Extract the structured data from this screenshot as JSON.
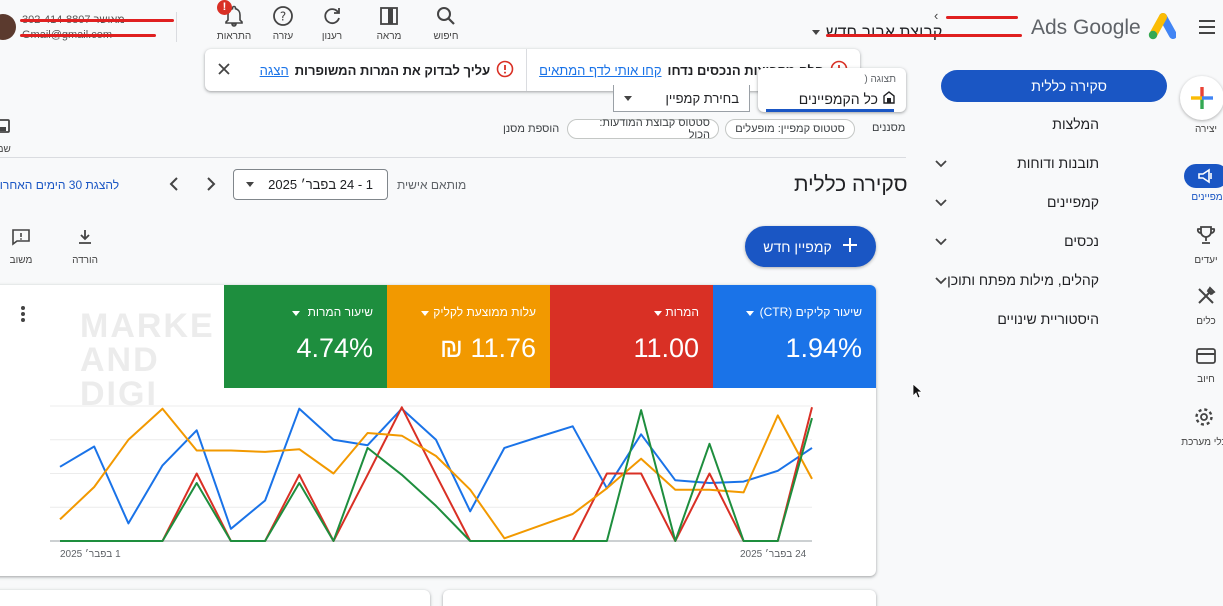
{
  "app": {
    "brand_text": "Ads Google",
    "account_name": "קבוצת אבוב חדש"
  },
  "user": {
    "phone": "302-414-8807 מאושר",
    "email": "Gmail@gmail.com"
  },
  "top_icons": [
    {
      "label": "חיפוש",
      "icon": "search-icon"
    },
    {
      "label": "מראה",
      "icon": "appearance-icon"
    },
    {
      "label": "רענון",
      "icon": "refresh-icon"
    },
    {
      "label": "עזרה",
      "icon": "help-icon"
    },
    {
      "label": "התראות",
      "icon": "bell-icon",
      "badge": "!"
    }
  ],
  "alert": {
    "left_text": "עליך לבדוק את המרות המשופרות",
    "left_link": "הצגה",
    "right_text": "חלק מקבוצות הנכסים נדחו",
    "right_link": "קחו אותי לדף המתאים"
  },
  "rail": [
    {
      "label": "יצירה",
      "icon": "create-plus-icon"
    },
    {
      "label": "קמפיינים",
      "icon": "campaigns-icon",
      "active": true
    },
    {
      "label": "יעדים",
      "icon": "trophy-icon"
    },
    {
      "label": "כלים",
      "icon": "tools-icon"
    },
    {
      "label": "חיוב",
      "icon": "billing-icon"
    },
    {
      "label": "כלי מערכת",
      "icon": "settings-icon"
    }
  ],
  "side_nav": {
    "active": "סקירה כללית",
    "items": [
      {
        "label": "המלצות",
        "chevron": false
      },
      {
        "label": "תובנות ודוחות",
        "chevron": true
      },
      {
        "label": "קמפיינים",
        "chevron": true
      },
      {
        "label": "נכסים",
        "chevron": true
      },
      {
        "label": "קהלים, מילות מפתח ותוכן",
        "chevron": true
      },
      {
        "label": "היסטוריית שינויים",
        "chevron": false
      }
    ]
  },
  "view_selector": {
    "label": "תצוגה (",
    "value": "כל הקמפיינים"
  },
  "campaign_selector": {
    "value": "בחירת קמפיין"
  },
  "filters": {
    "label": "מסננים",
    "chips": [
      "סטטוס קמפיין: מופעלים",
      "סטטוס קבוצת המודעות: הכול"
    ],
    "add": "הוספת מסנן"
  },
  "save_label": "שמי",
  "page_title": "סקירה כללית",
  "date": {
    "custom_label": "מותאם אישית",
    "range": "1 - 24 בפבר׳ 2025",
    "last_30": "להצגת 30 הימים האחרוני"
  },
  "actions": {
    "download": "הורדה",
    "feedback": "משוב"
  },
  "new_campaign": "קמפיין חדש",
  "metrics": [
    {
      "label": "שיעור קליקים (CTR)",
      "value": "1.94%",
      "color": "#1a73e8"
    },
    {
      "label": "המרות",
      "value": "11.00",
      "color": "#d93025"
    },
    {
      "label": "עלות ממוצעת לקליק",
      "value": "11.76 ₪",
      "color": "#f29900"
    },
    {
      "label": "שיעור המרות",
      "value": "4.74%",
      "color": "#1e8e3e"
    }
  ],
  "watermark": "MARKE AND DIGI",
  "chart_data": {
    "type": "line",
    "x": [
      "1",
      "2",
      "3",
      "4",
      "5",
      "6",
      "7",
      "8",
      "9",
      "10",
      "11",
      "12",
      "13",
      "14",
      "15",
      "16",
      "17",
      "18",
      "19",
      "20",
      "21",
      "22",
      "23",
      "24"
    ],
    "x_tick_labels": {
      "start": "1 בפבר׳ 2025",
      "end": "24 בפבר׳ 2025"
    },
    "ylim": [
      0,
      1
    ],
    "grid": true,
    "series": [
      {
        "color": "#1a73e8",
        "values": [
          0.55,
          0.7,
          0.13,
          0.56,
          0.82,
          0.09,
          0.3,
          0.98,
          0.75,
          0.71,
          0.98,
          0.75,
          0.22,
          0.69,
          0.77,
          0.85,
          0.39,
          0.79,
          0.45,
          0.43,
          0.44,
          0.52,
          0.69
        ]
      },
      {
        "color": "#d93025",
        "values": [
          0.0,
          0.0,
          0.0,
          0.0,
          0.5,
          0.0,
          0.0,
          0.49,
          0.0,
          0.49,
          0.99,
          0.49,
          0.0,
          0.0,
          0.0,
          0.0,
          0.5,
          0.5,
          0.0,
          0.5,
          0.0,
          0.0,
          0.99
        ]
      },
      {
        "color": "#f29900",
        "values": [
          0.16,
          0.4,
          0.75,
          0.98,
          0.67,
          0.67,
          0.66,
          0.68,
          0.5,
          0.8,
          0.78,
          0.63,
          0.38,
          0.02,
          0.11,
          0.2,
          0.39,
          0.61,
          0.38,
          0.38,
          0.36,
          0.93,
          0.46
        ]
      },
      {
        "color": "#1e8e3e",
        "values": [
          0.0,
          0.0,
          0.0,
          0.0,
          0.43,
          0.0,
          0.0,
          0.43,
          0.0,
          0.69,
          0.49,
          0.26,
          0.0,
          0.0,
          0.0,
          0.0,
          0.0,
          0.97,
          0.0,
          0.72,
          0.0,
          0.0,
          0.91
        ]
      }
    ]
  }
}
